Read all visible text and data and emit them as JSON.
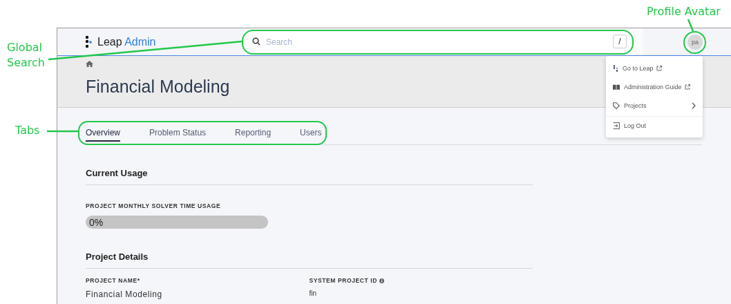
{
  "callouts": [
    {
      "kind": "search",
      "label": "Global Search"
    },
    {
      "kind": "tabs",
      "label": "Tabs"
    },
    {
      "kind": "avatar",
      "label": "Profile Avatar"
    }
  ],
  "header": {
    "logo_name": "Leap",
    "logo_accent": "Admin",
    "search": {
      "placeholder": "Search",
      "shortcut": "/"
    },
    "avatar": "pa"
  },
  "user_menu": {
    "items": [
      {
        "kind": "external",
        "label": "Go to Leap"
      },
      {
        "kind": "external",
        "label": "Administration Guide"
      },
      {
        "kind": "submenu",
        "label": "Projects"
      },
      {
        "kind": "action",
        "label": "Log Out"
      }
    ]
  },
  "title": "Financial Modeling",
  "tabs": [
    {
      "label": "Overview",
      "selected": true
    },
    {
      "label": "Problem Status",
      "selected": false
    },
    {
      "label": "Reporting",
      "selected": false
    },
    {
      "label": "Users",
      "selected": false
    }
  ],
  "usage": {
    "heading": "Current Usage",
    "label": "PROJECT MONTHLY SOLVER TIME USAGE",
    "level": 0,
    "reading": "0%"
  },
  "details": {
    "heading": "Project Details",
    "fields": [
      {
        "label": "PROJECT NAME*",
        "value": "Financial Modeling",
        "info": false
      },
      {
        "label": "SYSTEM PROJECT ID",
        "value": "fin",
        "info": true
      }
    ]
  }
}
